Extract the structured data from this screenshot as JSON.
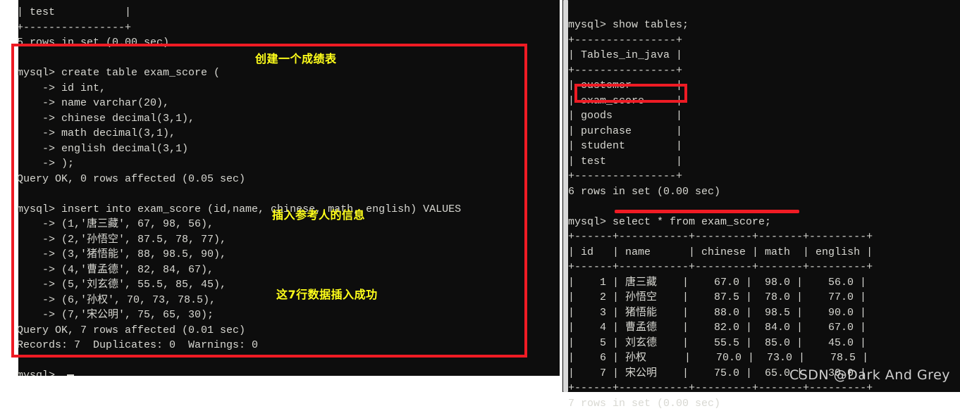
{
  "terminal": {
    "left_panel": {
      "lines": [
        "| test           |",
        "+----------------+",
        "5 rows in set (0.00 sec)",
        "",
        "mysql> create table exam_score (",
        "    -> id int,",
        "    -> name varchar(20),",
        "    -> chinese decimal(3,1),",
        "    -> math decimal(3,1),",
        "    -> english decimal(3,1)",
        "    -> );",
        "Query OK, 0 rows affected (0.05 sec)",
        "",
        "mysql> insert into exam_score (id,name, chinese, math, english) VALUES",
        "    -> (1,'唐三藏', 67, 98, 56),",
        "    -> (2,'孙悟空', 87.5, 78, 77),",
        "    -> (3,'猪悟能', 88, 98.5, 90),",
        "    -> (4,'曹孟德', 82, 84, 67),",
        "    -> (5,'刘玄德', 55.5, 85, 45),",
        "    -> (6,'孙权', 70, 73, 78.5),",
        "    -> (7,'宋公明', 75, 65, 30);",
        "Query OK, 7 rows affected (0.01 sec)",
        "Records: 7  Duplicates: 0  Warnings: 0",
        "",
        "mysql> "
      ]
    },
    "right_panel": {
      "lines": [
        "mysql> show tables;",
        "+----------------+",
        "| Tables_in_java |",
        "+----------------+",
        "| customer       |",
        "| exam_score     |",
        "| goods          |",
        "| purchase       |",
        "| student        |",
        "| test           |",
        "+----------------+",
        "6 rows in set (0.00 sec)",
        "",
        "mysql> select * from exam_score;",
        "+------+-----------+---------+-------+---------+",
        "| id   | name      | chinese | math  | english |",
        "+------+-----------+---------+-------+---------+",
        "|    1 | 唐三藏    |    67.0 |  98.0 |    56.0 |",
        "|    2 | 孙悟空    |    87.5 |  78.0 |    77.0 |",
        "|    3 | 猪悟能    |    88.0 |  98.5 |    90.0 |",
        "|    4 | 曹孟德    |    82.0 |  84.0 |    67.0 |",
        "|    5 | 刘玄德    |    55.5 |  85.0 |    45.0 |",
        "|    6 | 孙权      |    70.0 |  73.0 |    78.5 |",
        "|    7 | 宋公明    |    75.0 |  65.0 |    30.0 |",
        "+------+-----------+---------+-------+---------+",
        "7 rows in set (0.00 sec)"
      ]
    }
  },
  "annotations": {
    "create_table_note": "创建一个成绩表",
    "insert_rows_note": "插入参考人的信息",
    "insert_success_note": "这7行数据插入成功"
  },
  "highlights": {
    "left_block_color": "#ee1b24",
    "exam_score_box_color": "#ee1b24",
    "select_underline_color": "#f01b24"
  },
  "watermark": {
    "text": "CSDN @Dark And Grey"
  },
  "query_results": {
    "show_tables": {
      "header": "Tables_in_java",
      "rows": [
        "customer",
        "exam_score",
        "goods",
        "purchase",
        "student",
        "test"
      ],
      "footer": "6 rows in set (0.00 sec)"
    },
    "select_exam_score": {
      "columns": [
        "id",
        "name",
        "chinese",
        "math",
        "english"
      ],
      "rows": [
        [
          "1",
          "唐三藏",
          "67.0",
          "98.0",
          "56.0"
        ],
        [
          "2",
          "孙悟空",
          "87.5",
          "78.0",
          "77.0"
        ],
        [
          "3",
          "猪悟能",
          "88.0",
          "98.5",
          "90.0"
        ],
        [
          "4",
          "曹孟德",
          "82.0",
          "84.0",
          "67.0"
        ],
        [
          "5",
          "刘玄德",
          "55.5",
          "85.0",
          "45.0"
        ],
        [
          "6",
          "孙权",
          "70.0",
          "73.0",
          "78.5"
        ],
        [
          "7",
          "宋公明",
          "75.0",
          "65.0",
          "30.0"
        ]
      ],
      "footer": "7 rows in set (0.00 sec)"
    }
  }
}
